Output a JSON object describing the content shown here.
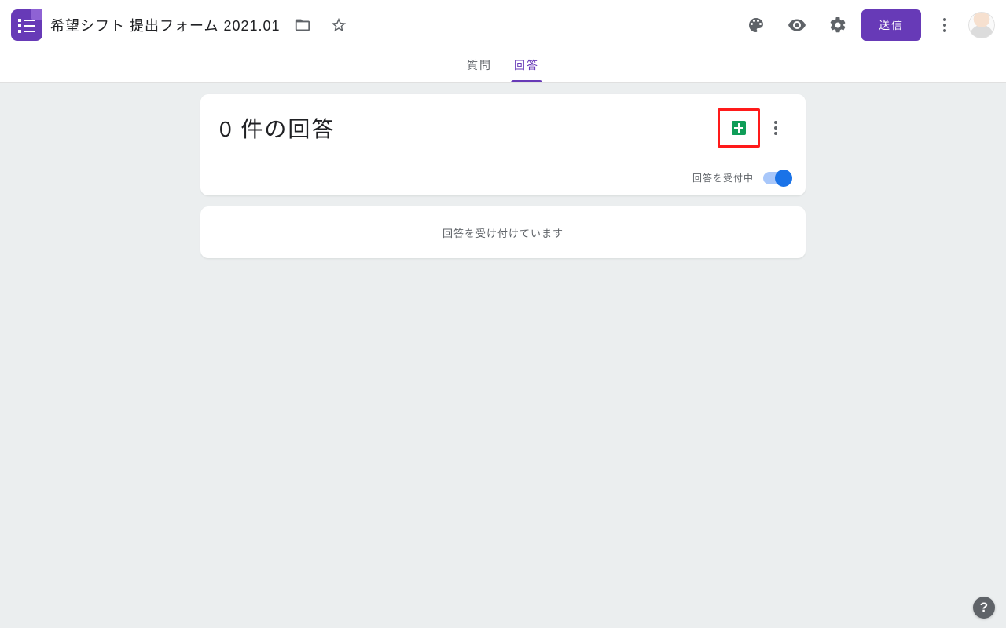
{
  "header": {
    "form_title": "希望シフト 提出フォーム 2021.01",
    "folder_icon": "folder-icon",
    "star_icon": "star-icon",
    "palette_icon": "palette-icon",
    "preview_icon": "eye-icon",
    "settings_icon": "gear-icon",
    "send_label": "送信",
    "overflow_icon": "more-vertical-icon",
    "avatar": "user-avatar"
  },
  "tabs": {
    "questions": "質問",
    "responses": "回答"
  },
  "responses": {
    "count_text": "0 件の回答",
    "sheets_icon": "sheets-icon",
    "more_icon": "more-vertical-icon",
    "accepting_label": "回答を受付中",
    "status_message": "回答を受け付けています"
  },
  "help": {
    "char": "?"
  },
  "colors": {
    "accent": "#673ab7",
    "sheets_green": "#0f9d58",
    "switch_on": "#1a73e8",
    "highlight": "#ff1a1a"
  }
}
